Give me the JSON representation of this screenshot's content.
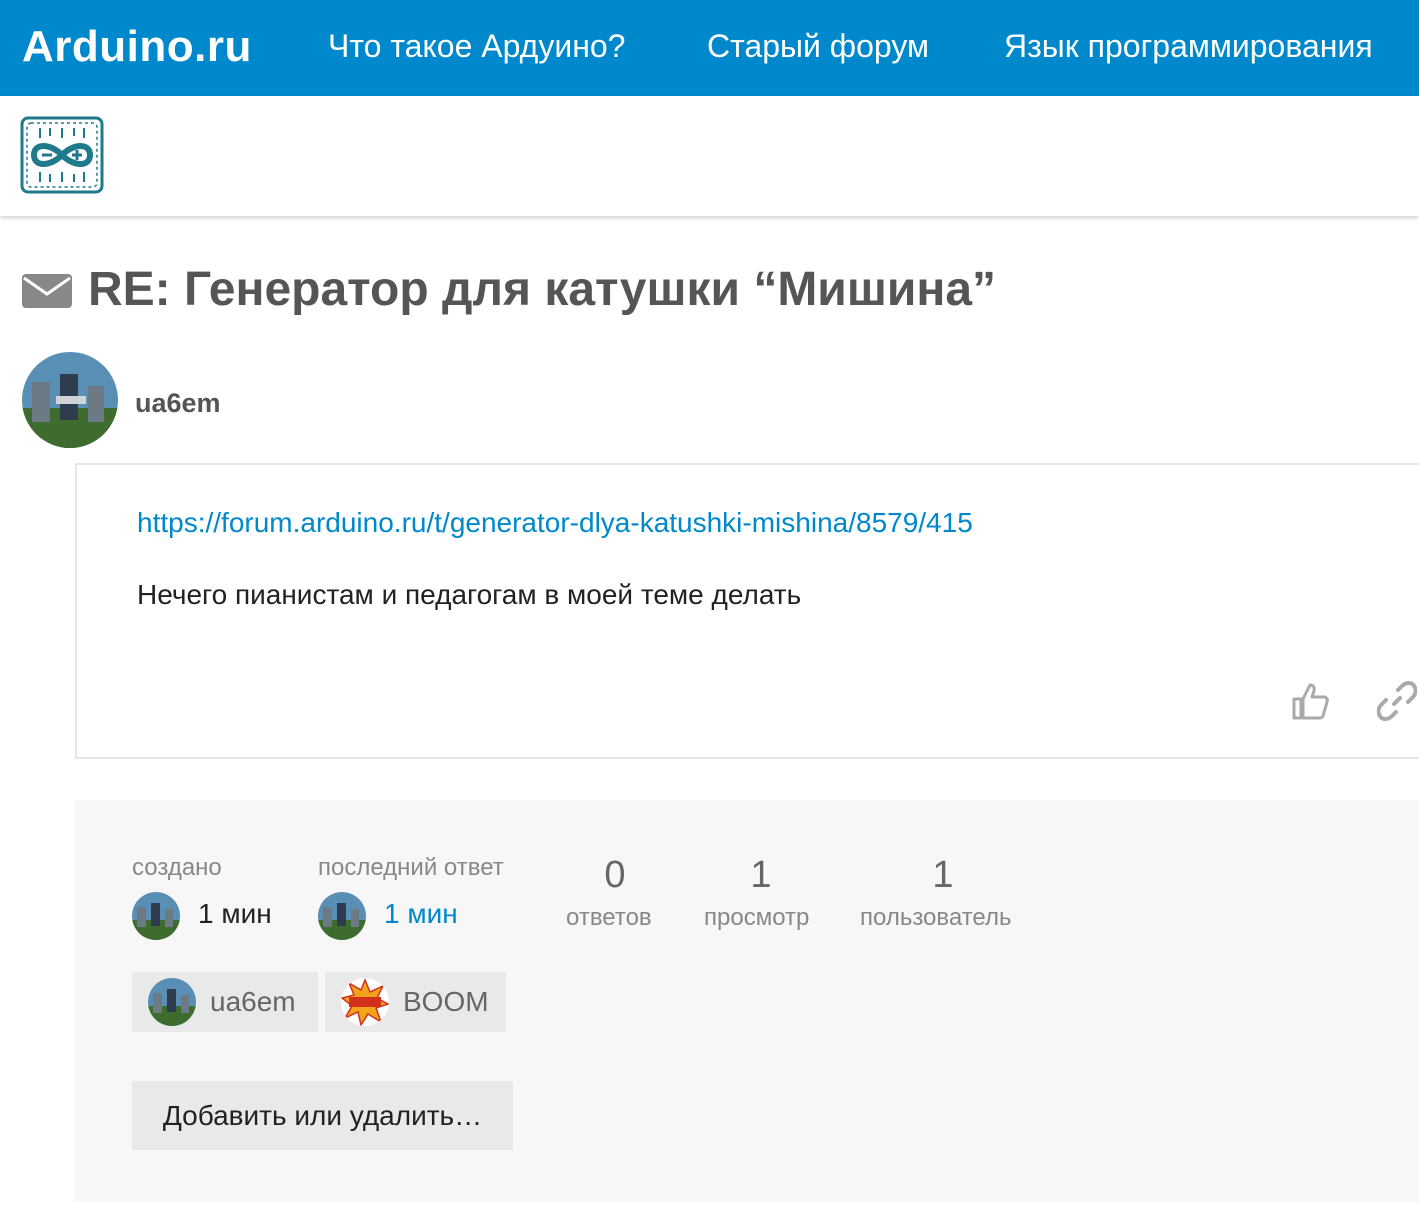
{
  "topbar": {
    "brand": "Arduino.ru",
    "nav": [
      "Что такое Ардуино?",
      "Старый форум",
      "Язык программирования"
    ]
  },
  "topic": {
    "title": "RE: Генератор для катушки “Мишина”"
  },
  "post": {
    "author": "ua6em",
    "link": "https://forum.arduino.ru/t/generator-dlya-katushki-mishina/8579/415",
    "text": "Нечего пианистам и педагогам в моей теме делать"
  },
  "meta": {
    "created_label": "создано",
    "created_time": "1 мин",
    "last_reply_label": "последний ответ",
    "last_reply_time": "1 мин",
    "stats": [
      {
        "value": "0",
        "label": "ответов"
      },
      {
        "value": "1",
        "label": "просмотр"
      },
      {
        "value": "1",
        "label": "пользователь"
      }
    ],
    "participants": [
      "ua6em",
      "BOOM"
    ],
    "add_button": "Добавить или удалить…"
  },
  "colors": {
    "brand_blue": "#0088cc",
    "muted_text": "#888888",
    "meta_bg": "#f7f7f7"
  },
  "icons": {
    "title_icon": "envelope-icon",
    "like": "thumbs-up-icon",
    "share": "link-icon"
  }
}
